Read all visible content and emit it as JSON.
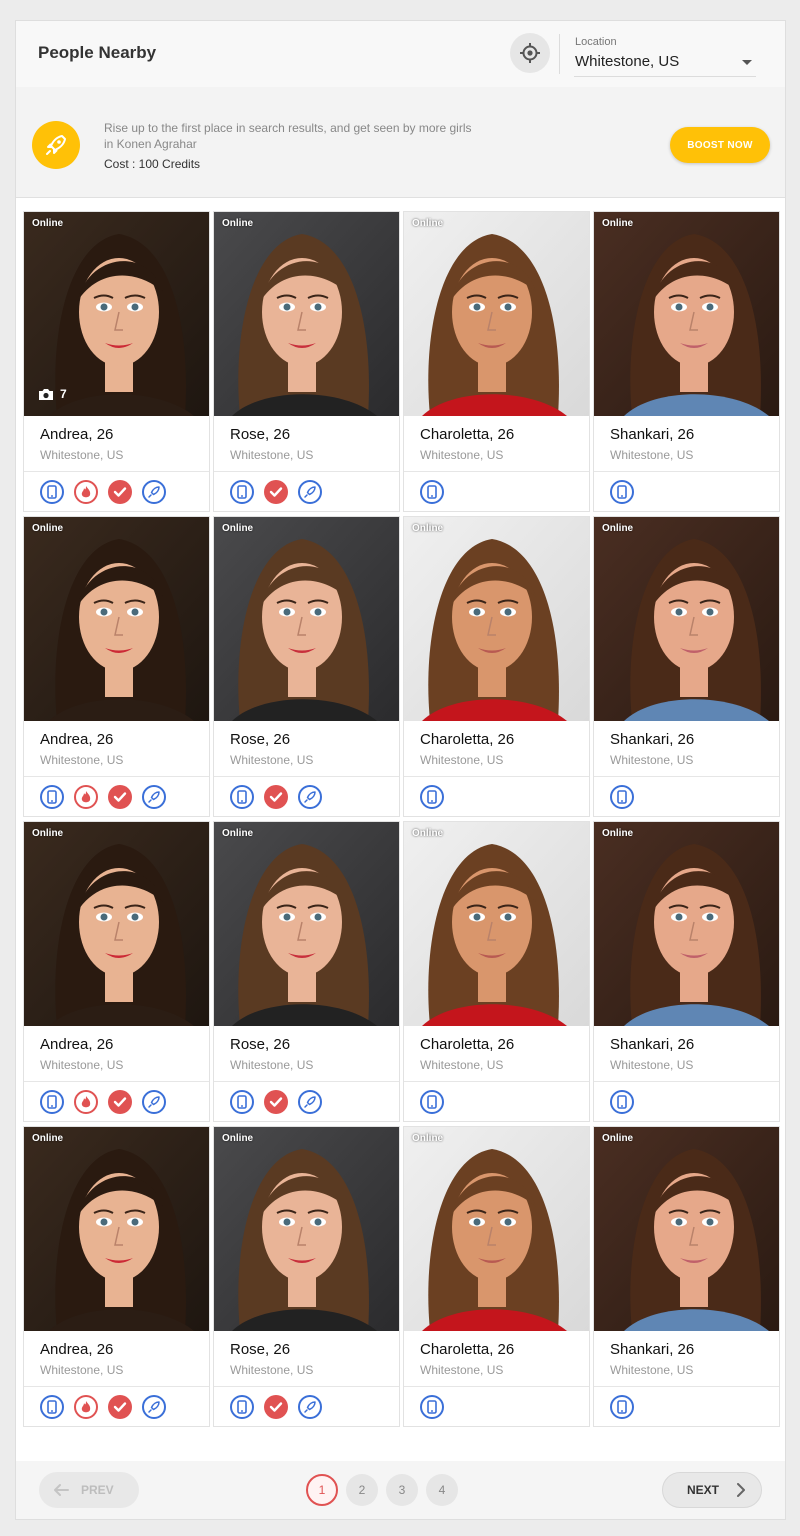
{
  "header": {
    "title": "People Nearby",
    "location_label": "Location",
    "location_value": "Whitestone, US"
  },
  "boost": {
    "text": "Rise up to the first place in search results, and get seen by more girls in Konen Agrahar",
    "cost": "Cost : 100 Credits",
    "button": "BOOST NOW",
    "icon": "rocket-icon"
  },
  "status_label": "Online",
  "rows": [
    [
      {
        "name": "Andrea, 26",
        "city": "Whitestone, US",
        "photo_count": "7",
        "badges": [
          "phone-icon",
          "fire-icon",
          "verified-icon",
          "rocket-icon"
        ]
      },
      {
        "name": "Rose, 26",
        "city": "Whitestone, US",
        "badges": [
          "phone-icon",
          "verified-icon",
          "rocket-icon"
        ]
      },
      {
        "name": "Charoletta, 26",
        "city": "Whitestone, US",
        "badges": [
          "phone-icon"
        ]
      },
      {
        "name": "Shankari, 26",
        "city": "Whitestone, US",
        "badges": [
          "phone-icon"
        ]
      }
    ],
    [
      {
        "name": "Andrea, 26",
        "city": "Whitestone, US",
        "badges": [
          "phone-icon",
          "fire-icon",
          "verified-icon",
          "rocket-icon"
        ]
      },
      {
        "name": "Rose, 26",
        "city": "Whitestone, US",
        "badges": [
          "phone-icon",
          "verified-icon",
          "rocket-icon"
        ]
      },
      {
        "name": "Charoletta, 26",
        "city": "Whitestone, US",
        "badges": [
          "phone-icon"
        ]
      },
      {
        "name": "Shankari, 26",
        "city": "Whitestone, US",
        "badges": [
          "phone-icon"
        ]
      }
    ],
    [
      {
        "name": "Andrea, 26",
        "city": "Whitestone, US",
        "badges": [
          "phone-icon",
          "fire-icon",
          "verified-icon",
          "rocket-icon"
        ]
      },
      {
        "name": "Rose, 26",
        "city": "Whitestone, US",
        "badges": [
          "phone-icon",
          "verified-icon",
          "rocket-icon"
        ]
      },
      {
        "name": "Charoletta, 26",
        "city": "Whitestone, US",
        "badges": [
          "phone-icon"
        ]
      },
      {
        "name": "Shankari, 26",
        "city": "Whitestone, US",
        "badges": [
          "phone-icon"
        ]
      }
    ],
    [
      {
        "name": "Andrea, 26",
        "city": "Whitestone, US",
        "badges": [
          "phone-icon",
          "fire-icon",
          "verified-icon",
          "rocket-icon"
        ]
      },
      {
        "name": "Rose, 26",
        "city": "Whitestone, US",
        "badges": [
          "phone-icon",
          "verified-icon",
          "rocket-icon"
        ]
      },
      {
        "name": "Charoletta, 26",
        "city": "Whitestone, US",
        "badges": [
          "phone-icon"
        ]
      },
      {
        "name": "Shankari, 26",
        "city": "Whitestone, US",
        "badges": [
          "phone-icon"
        ]
      }
    ]
  ],
  "pagination": {
    "prev": "PREV",
    "next": "NEXT",
    "pages": [
      "1",
      "2",
      "3",
      "4"
    ],
    "current": "1"
  },
  "colors": {
    "accent": "#ffc107",
    "brand_red": "#e05252",
    "brand_blue": "#3a6fd8"
  }
}
